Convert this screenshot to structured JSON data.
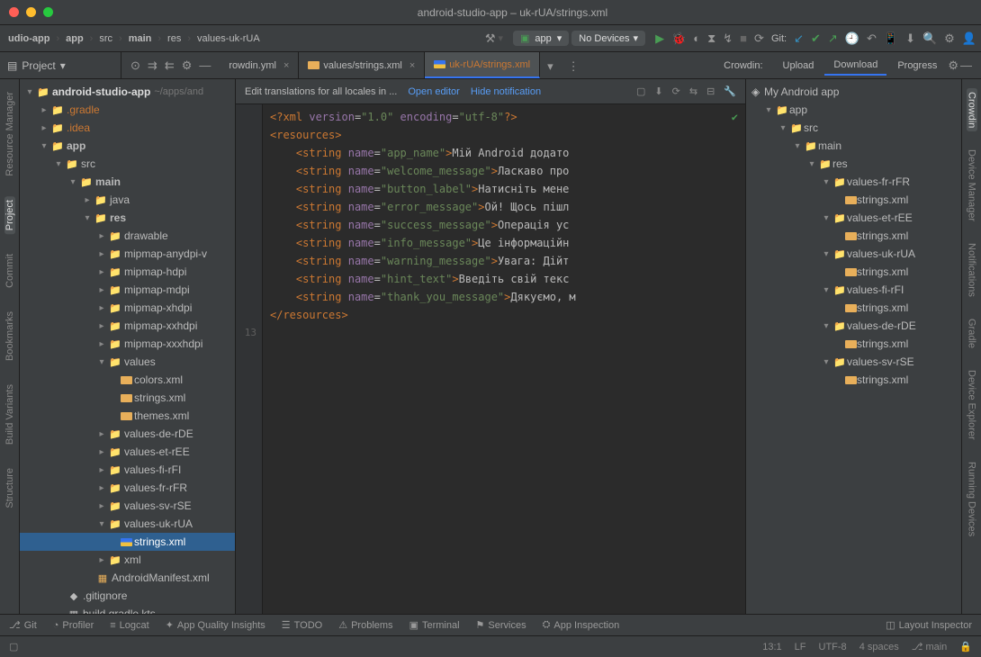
{
  "title": "android-studio-app – uk-rUA/strings.xml",
  "breadcrumbs": [
    "udio-app",
    "app",
    "src",
    "main",
    "res",
    "values-uk-rUA"
  ],
  "runConfig": "app",
  "devices": "No Devices",
  "gitLabel": "Git:",
  "projectSelector": "Project",
  "tabs": {
    "t0": {
      "label": "rowdin.yml"
    },
    "t1": {
      "label": "values/strings.xml"
    },
    "t2": {
      "label": "uk-rUA/strings.xml"
    }
  },
  "crowdinTabs": {
    "label": "Crowdin:",
    "upload": "Upload",
    "download": "Download",
    "progress": "Progress"
  },
  "banner": {
    "text": "Edit translations for all locales in ...",
    "openEditor": "Open editor",
    "hide": "Hide notification"
  },
  "tree": {
    "root": "android-studio-app",
    "rootDim": "~/apps/and",
    "gradle": ".gradle",
    "idea": ".idea",
    "app": "app",
    "src": "src",
    "main": "main",
    "java": "java",
    "res": "res",
    "drawable": "drawable",
    "mip1": "mipmap-anydpi-v",
    "mip2": "mipmap-hdpi",
    "mip3": "mipmap-mdpi",
    "mip4": "mipmap-xhdpi",
    "mip5": "mipmap-xxhdpi",
    "mip6": "mipmap-xxxhdpi",
    "values": "values",
    "colors": "colors.xml",
    "strings": "strings.xml",
    "themes": "themes.xml",
    "vDe": "values-de-rDE",
    "vEt": "values-et-rEE",
    "vFi": "values-fi-rFI",
    "vFr": "values-fr-rFR",
    "vSv": "values-sv-rSE",
    "vUk": "values-uk-rUA",
    "stringsUk": "strings.xml",
    "xml": "xml",
    "manifest": "AndroidManifest.xml",
    "gitignore": ".gitignore",
    "buildkts": "build.gradle.kts"
  },
  "code": {
    "l1": "<?xml version=\"1.0\" encoding=\"utf-8\"?>",
    "l2": "<resources>",
    "attrs": {
      "a1": "app_name",
      "a2": "welcome_message",
      "a3": "button_label",
      "a4": "error_message",
      "a5": "success_message",
      "a6": "info_message",
      "a7": "warning_message",
      "a8": "hint_text",
      "a9": "thank_you_message"
    },
    "vals": {
      "v1": "Мій Android додато",
      "v2": "Ласкаво про",
      "v3": "Натисніть мене",
      "v4": "Ой! Щось пішл",
      "v5": "Операція ус",
      "v6": "Це інформаційн",
      "v7": "Увага: Дійт",
      "v8": "Введіть свій текс",
      "v9": "Дякуємо, м"
    },
    "close": "</resources>",
    "lastLine": "13"
  },
  "crowdin": {
    "project": "My Android app",
    "app": "app",
    "src": "src",
    "main": "main",
    "res": "res",
    "l1": "values-fr-rFR",
    "l2": "values-et-rEE",
    "l3": "values-uk-rUA",
    "l4": "values-fi-rFI",
    "l5": "values-de-rDE",
    "l6": "values-sv-rSE",
    "file": "strings.xml"
  },
  "leftGutter": {
    "rm": "Resource Manager",
    "proj": "Project",
    "commit": "Commit",
    "bm": "Bookmarks",
    "bv": "Build Variants",
    "struct": "Structure"
  },
  "rightGutter": {
    "crowdin": "Crowdin",
    "dm": "Device Manager",
    "notif": "Notifications",
    "gradle": "Gradle",
    "de": "Device Explorer",
    "rd": "Running Devices"
  },
  "bottomBar": {
    "git": "Git",
    "profiler": "Profiler",
    "logcat": "Logcat",
    "aqi": "App Quality Insights",
    "todo": "TODO",
    "problems": "Problems",
    "terminal": "Terminal",
    "services": "Services",
    "appinsp": "App Inspection",
    "layout": "Layout Inspector"
  },
  "status": {
    "pos": "13:1",
    "lf": "LF",
    "enc": "UTF-8",
    "indent": "4 spaces",
    "branch": "main"
  }
}
